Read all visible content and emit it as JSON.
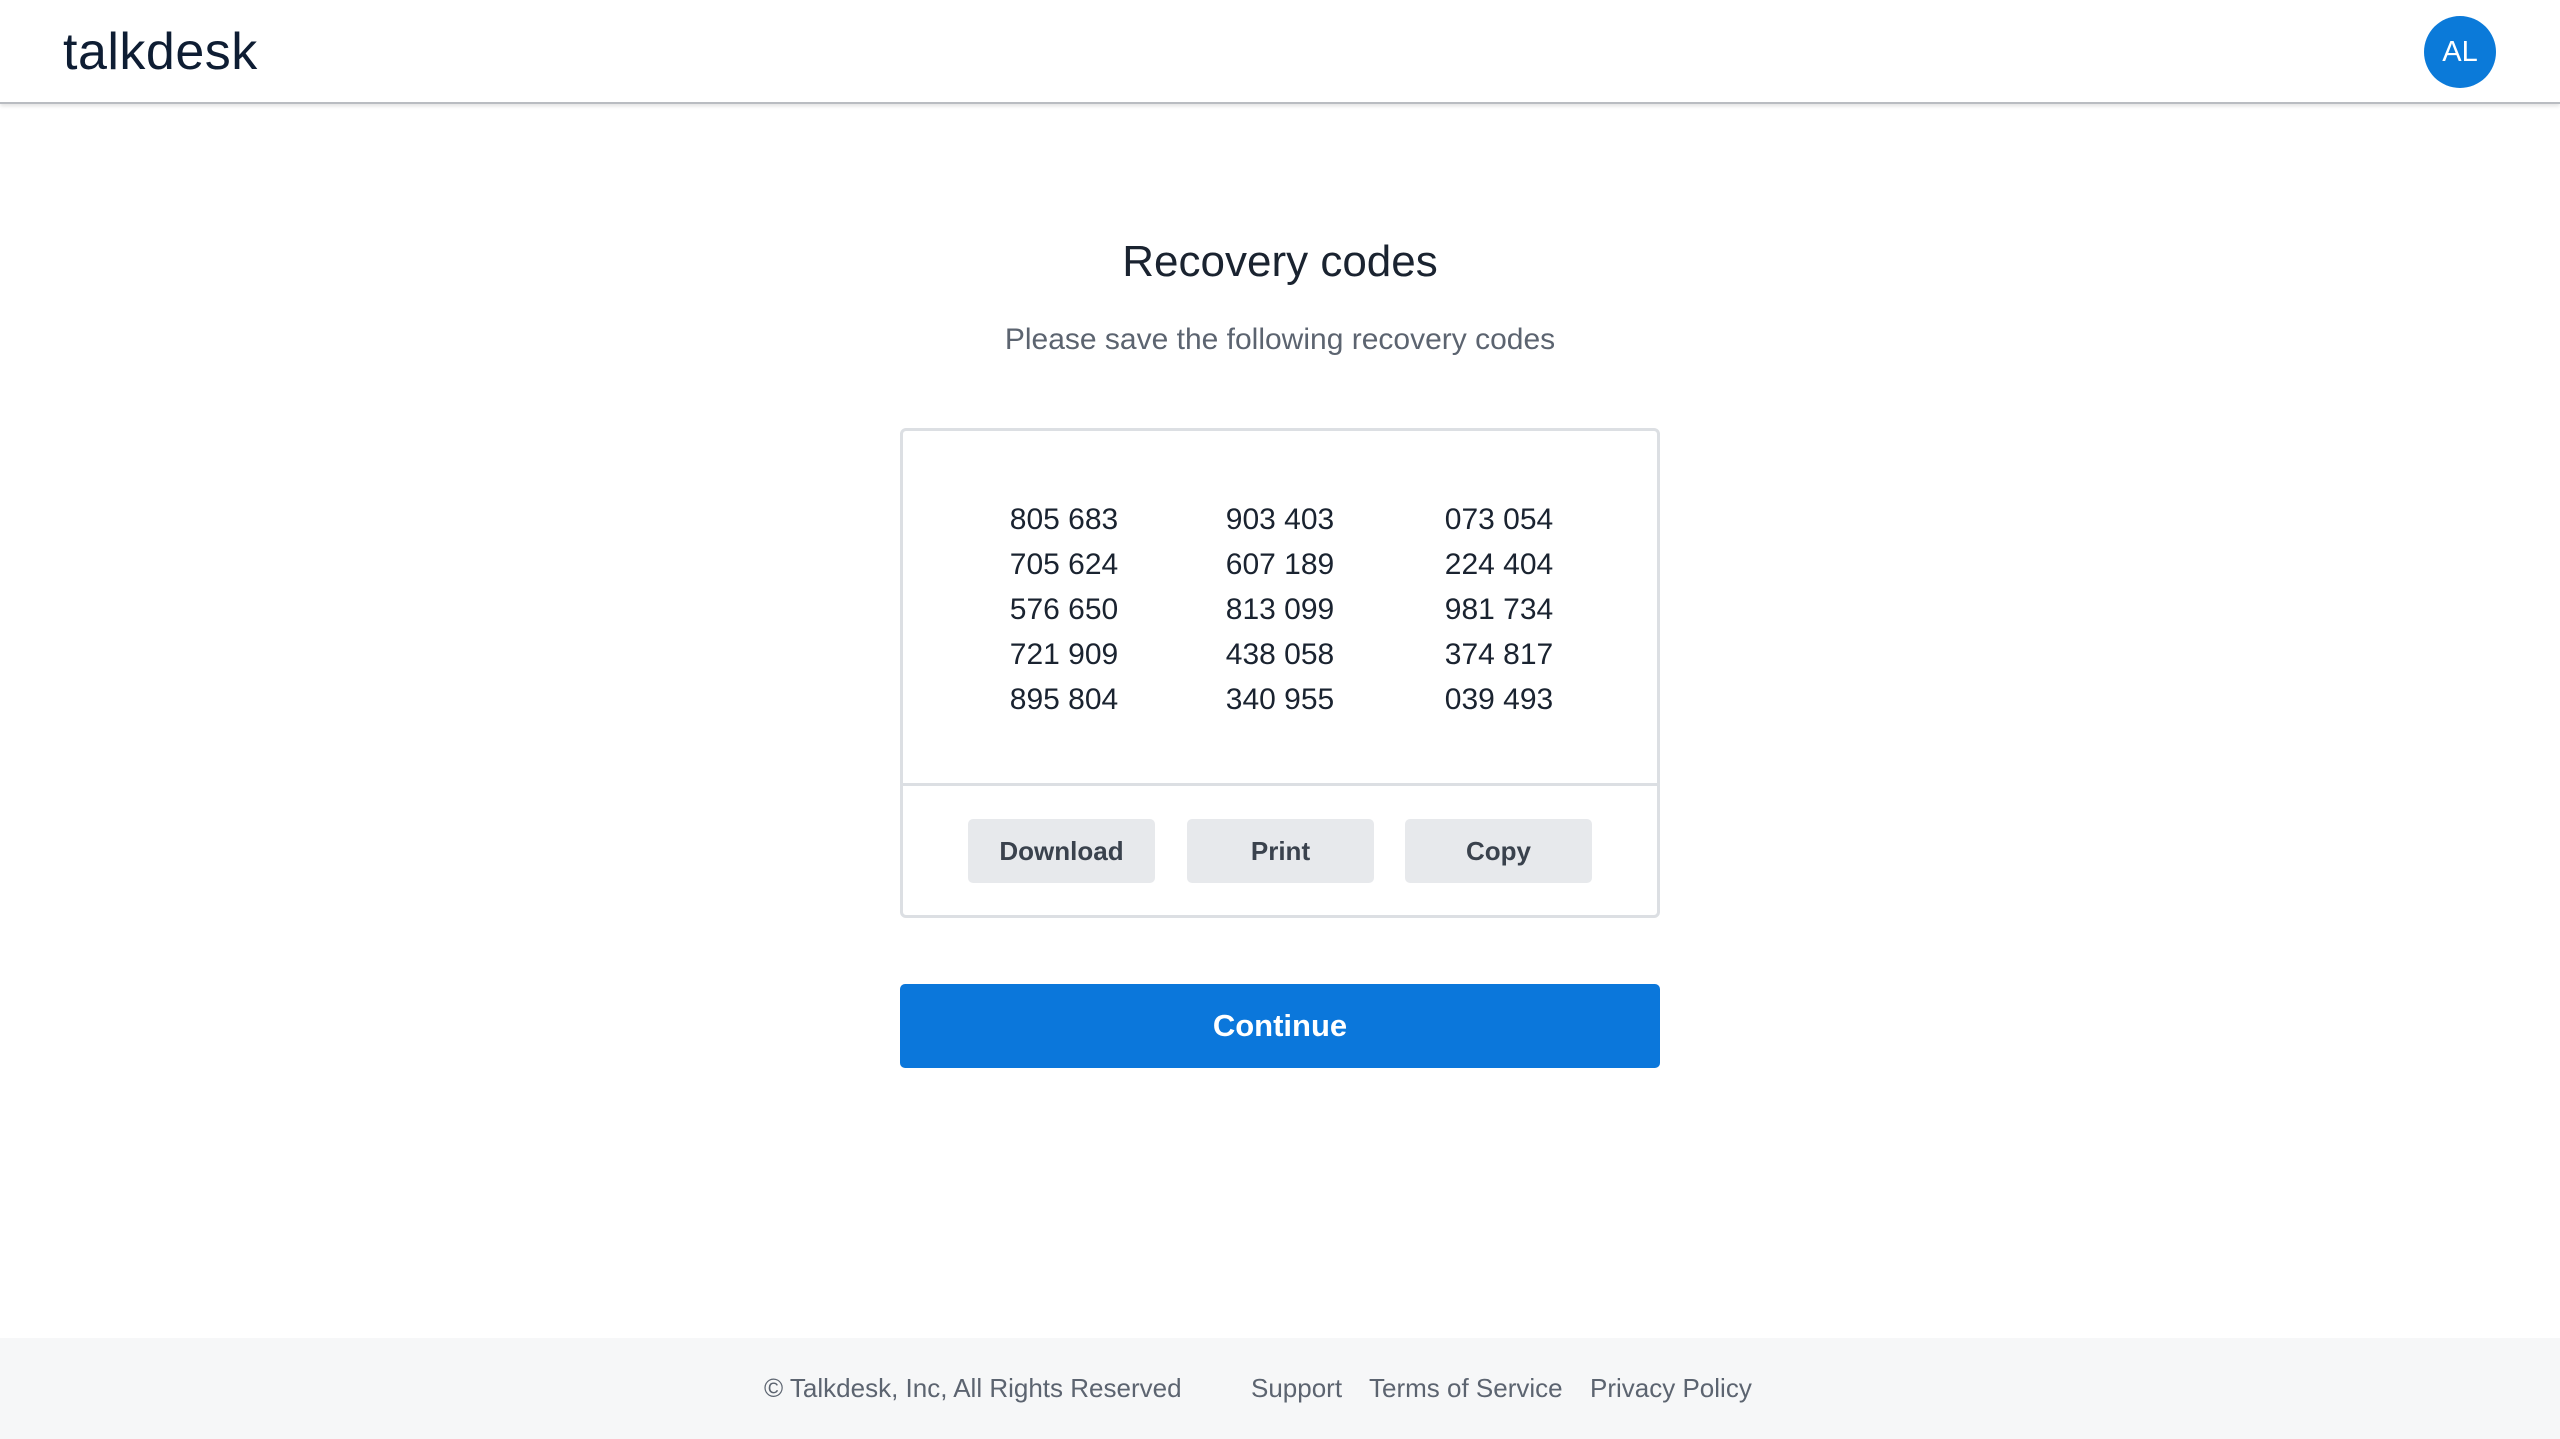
{
  "header": {
    "logo_text": "talkdesk",
    "avatar_initials": "AL",
    "avatar_color": "#0b7ad9"
  },
  "main": {
    "title": "Recovery codes",
    "subtitle": "Please save the following recovery codes",
    "codes": {
      "columns": [
        [
          "805 683",
          "705 624",
          "576 650",
          "721 909",
          "895 804"
        ],
        [
          "903 403",
          "607 189",
          "813 099",
          "438 058",
          "340 955"
        ],
        [
          "073 054",
          "224 404",
          "981 734",
          "374 817",
          "039 493"
        ]
      ]
    },
    "actions": {
      "download_label": "Download",
      "print_label": "Print",
      "copy_label": "Copy"
    },
    "continue_label": "Continue",
    "primary_color": "#0b77db"
  },
  "footer": {
    "copyright": "© Talkdesk, Inc, All Rights Reserved",
    "links": {
      "support": "Support",
      "terms": "Terms of Service",
      "privacy": "Privacy Policy"
    }
  }
}
